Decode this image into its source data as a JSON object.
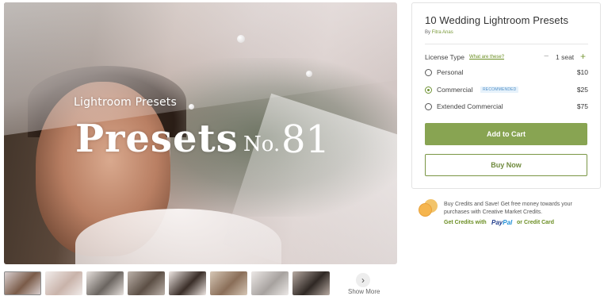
{
  "hero": {
    "overlay_subtitle": "Lightroom Presets",
    "overlay_title": "Presets",
    "overlay_no": "No.",
    "overlay_number": "81"
  },
  "thumbnails": [
    {
      "colors": [
        "#d9cfcf",
        "#7a5b48"
      ],
      "active": true
    },
    {
      "colors": [
        "#f1ecea",
        "#c9b3aa"
      ],
      "active": false
    },
    {
      "colors": [
        "#e6e0dc",
        "#6b6560"
      ],
      "active": false
    },
    {
      "colors": [
        "#bdb3ab",
        "#5c4f45"
      ],
      "active": false
    },
    {
      "colors": [
        "#efe7e3",
        "#3a2e28"
      ],
      "active": false
    },
    {
      "colors": [
        "#d6c7b6",
        "#8a6e58"
      ],
      "active": false
    },
    {
      "colors": [
        "#ece8e6",
        "#a7a29f"
      ],
      "active": false
    },
    {
      "colors": [
        "#b7aaa2",
        "#2f2824"
      ],
      "active": false
    }
  ],
  "show_more": {
    "icon": "chevron-right-icon",
    "label": "Show More"
  },
  "product": {
    "title": "10 Wedding Lightroom Presets",
    "by_prefix": "By",
    "author": "Fitra Anas"
  },
  "license": {
    "label": "License Type",
    "help_link": "What are these?",
    "seats_minus": "−",
    "seats_text": "1 seat",
    "seats_plus": "+",
    "options": [
      {
        "label": "Personal",
        "price": "$10",
        "selected": false,
        "badge": ""
      },
      {
        "label": "Commercial",
        "price": "$25",
        "selected": true,
        "badge": "RECOMMENDED"
      },
      {
        "label": "Extended Commercial",
        "price": "$75",
        "selected": false,
        "badge": ""
      }
    ]
  },
  "buttons": {
    "add_to_cart": "Add to Cart",
    "buy_now": "Buy Now"
  },
  "credits": {
    "text": "Buy Credits and Save! Get free money towards your purchases with Creative Market Credits.",
    "link_prefix": "Get Credits with",
    "paypal_pay": "Pay",
    "paypal_pal": "Pal",
    "link_alt": "or Credit Card"
  },
  "colors": {
    "accent_green": "#88a452",
    "link_green": "#6b8e23",
    "badge_blue": "#4f8fc7"
  }
}
